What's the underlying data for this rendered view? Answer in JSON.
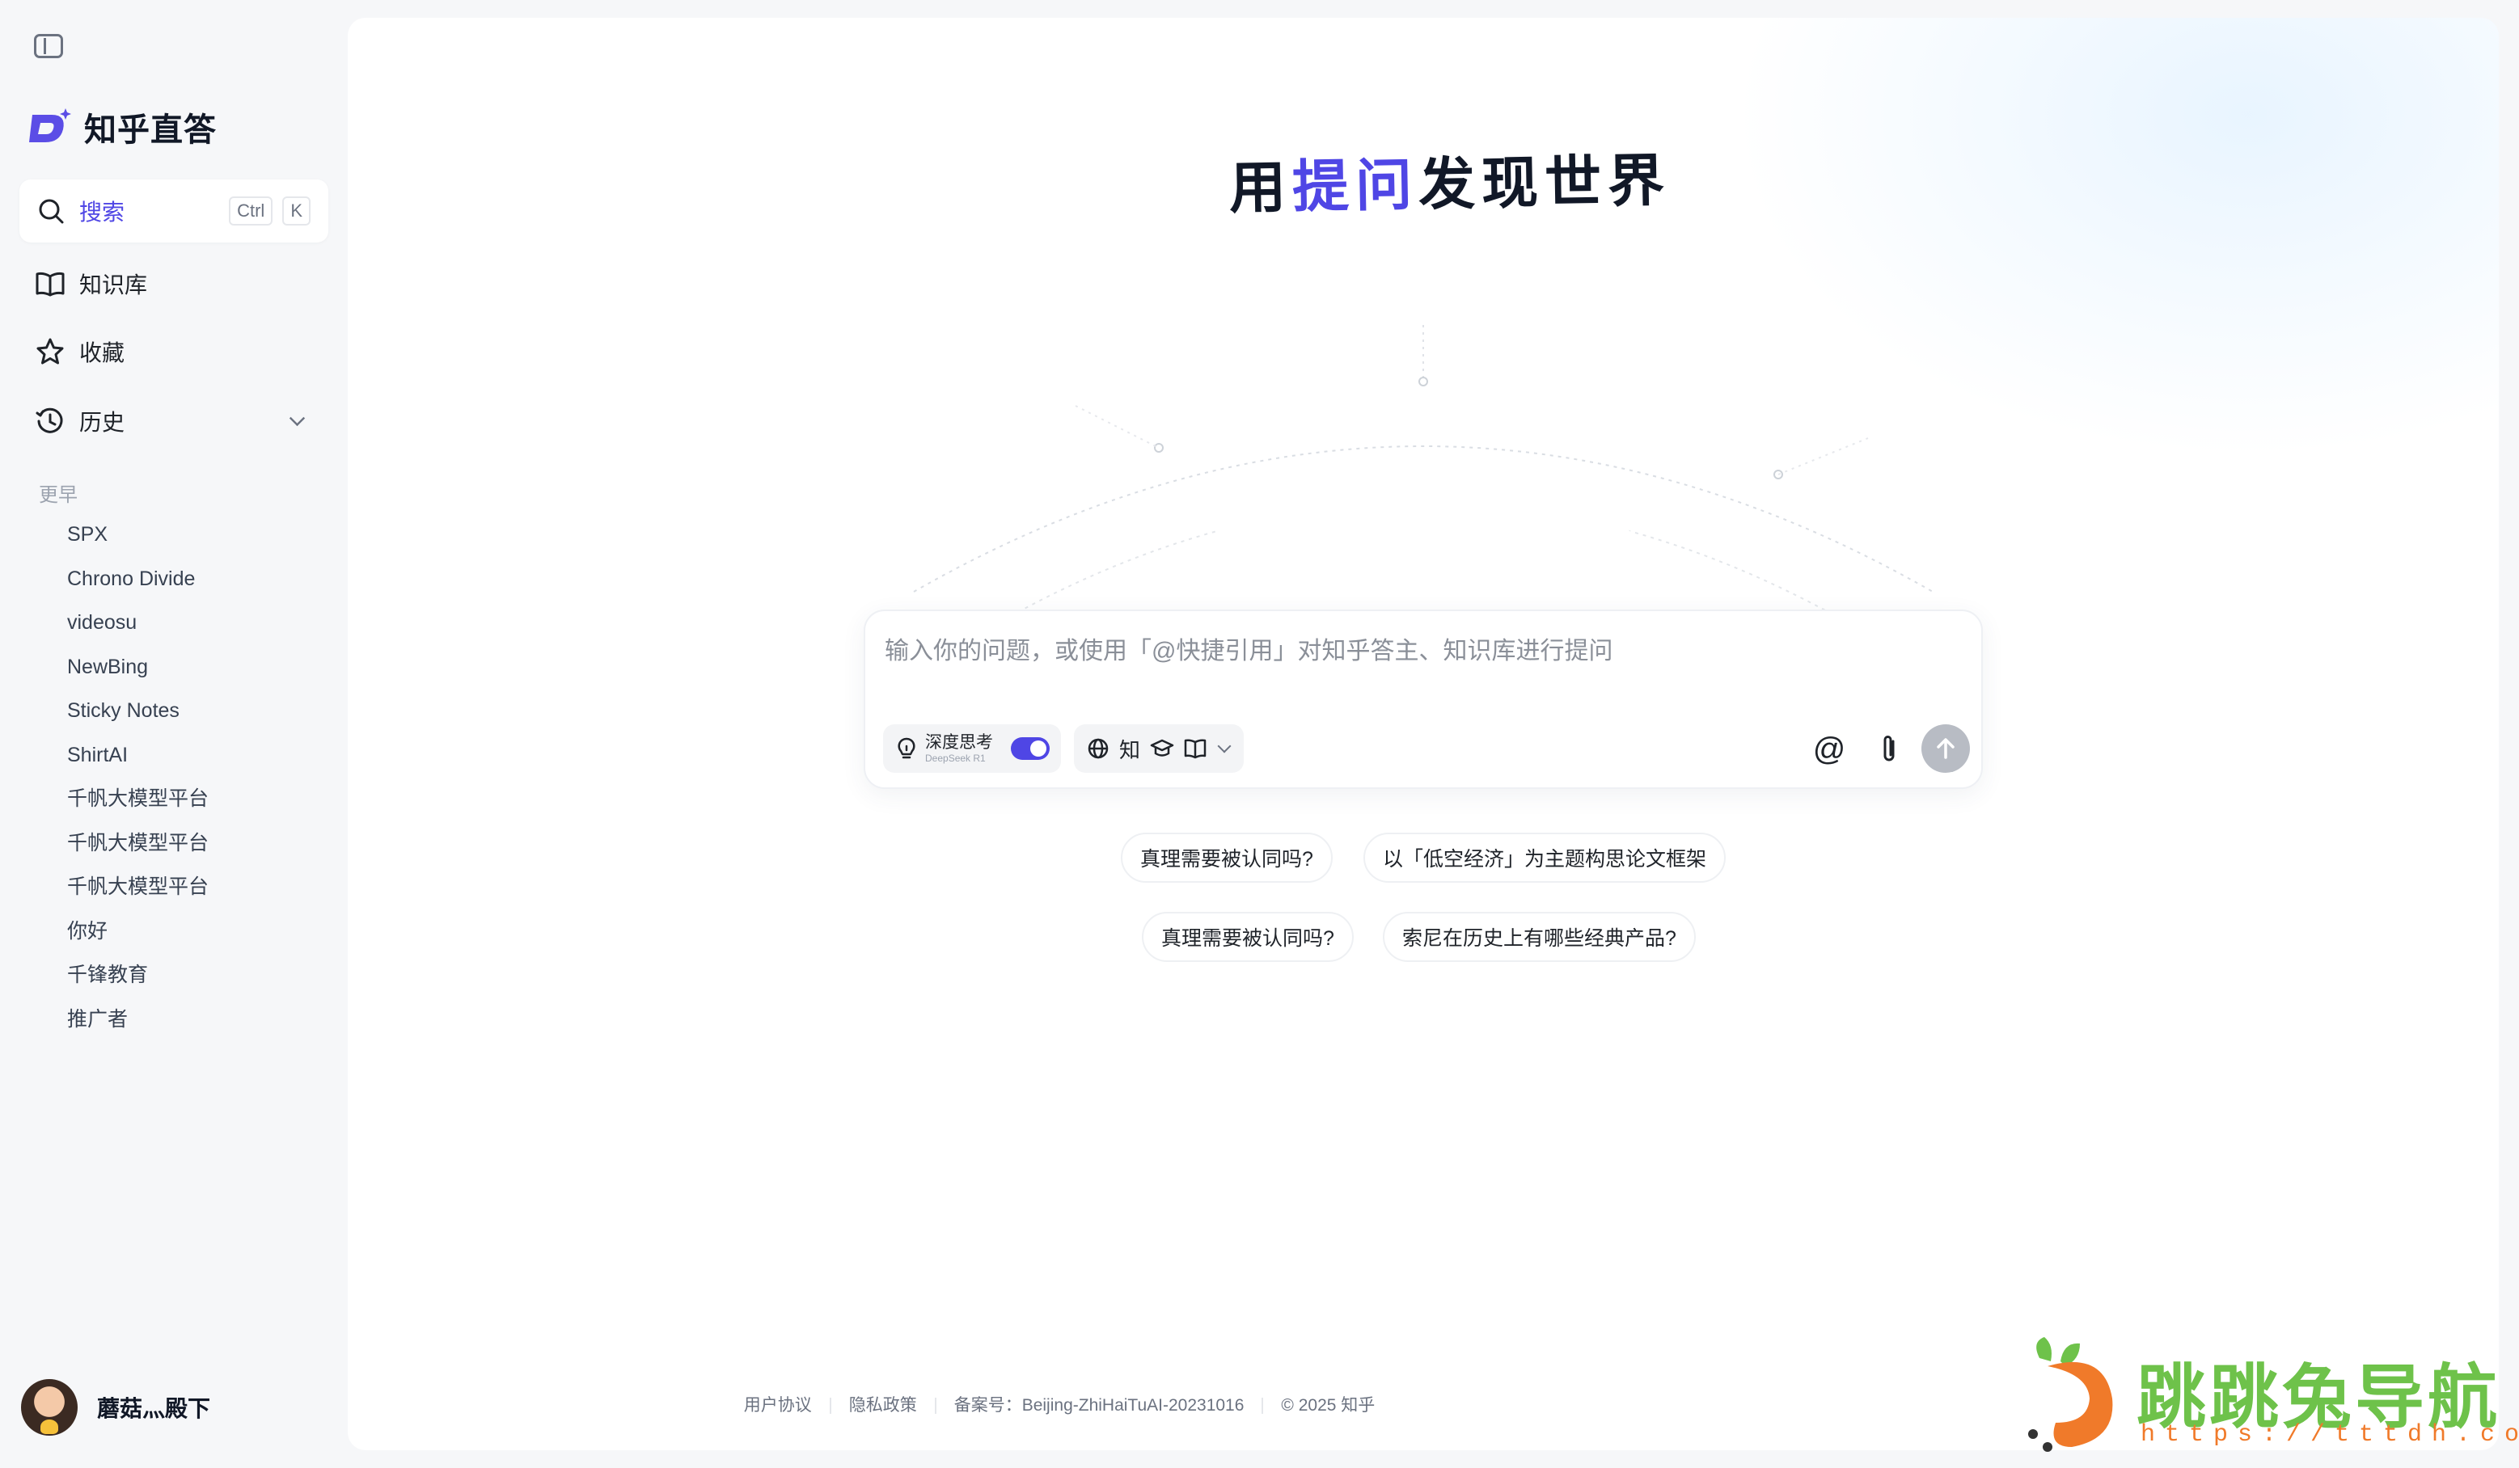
{
  "sidebar": {
    "brand": "知乎直答",
    "search": {
      "label": "搜索",
      "shortcut_1": "Ctrl",
      "shortcut_2": "K"
    },
    "nav": [
      {
        "label": "知识库",
        "icon": "book-icon"
      },
      {
        "label": "收藏",
        "icon": "star-icon"
      },
      {
        "label": "历史",
        "icon": "history-icon"
      }
    ],
    "history_section": "更早",
    "history": [
      "SPX",
      "Chrono Divide",
      "videosu",
      "NewBing",
      "Sticky Notes",
      "ShirtAI",
      "千帆大模型平台",
      "千帆大模型平台",
      "千帆大模型平台",
      "你好",
      "千锋教育",
      "推广者"
    ],
    "user": {
      "name": "蘑菇灬殿下"
    }
  },
  "hero": {
    "title_a": "用",
    "title_accent": "提问",
    "title_b": "发现世界"
  },
  "input": {
    "placeholder": "输入你的问题，或使用「@快捷引用」对知乎答主、知识库进行提问",
    "deep_think_title": "深度思考",
    "deep_think_sub": "DeepSeek R1",
    "deep_think_on": true,
    "source_zhi": "知",
    "at_label": "@"
  },
  "suggestions": [
    "真理需要被认同吗?",
    "以「低空经济」为主题构思论文框架",
    "真理需要被认同吗?",
    "索尼在历史上有哪些经典产品?"
  ],
  "footer": {
    "agreement": "用户协议",
    "privacy": "隐私政策",
    "icp": "备案号：Beijing-ZhiHaiTuAI-20231016",
    "copyright": "© 2025 知乎"
  },
  "watermark": {
    "text": "跳跳兔导航",
    "url": "https://tttdh.com"
  },
  "colors": {
    "accent": "#4f46e5",
    "send_disabled": "#b8bcc4",
    "watermark_green": "#6ec24a",
    "watermark_orange": "#f07a2a"
  }
}
